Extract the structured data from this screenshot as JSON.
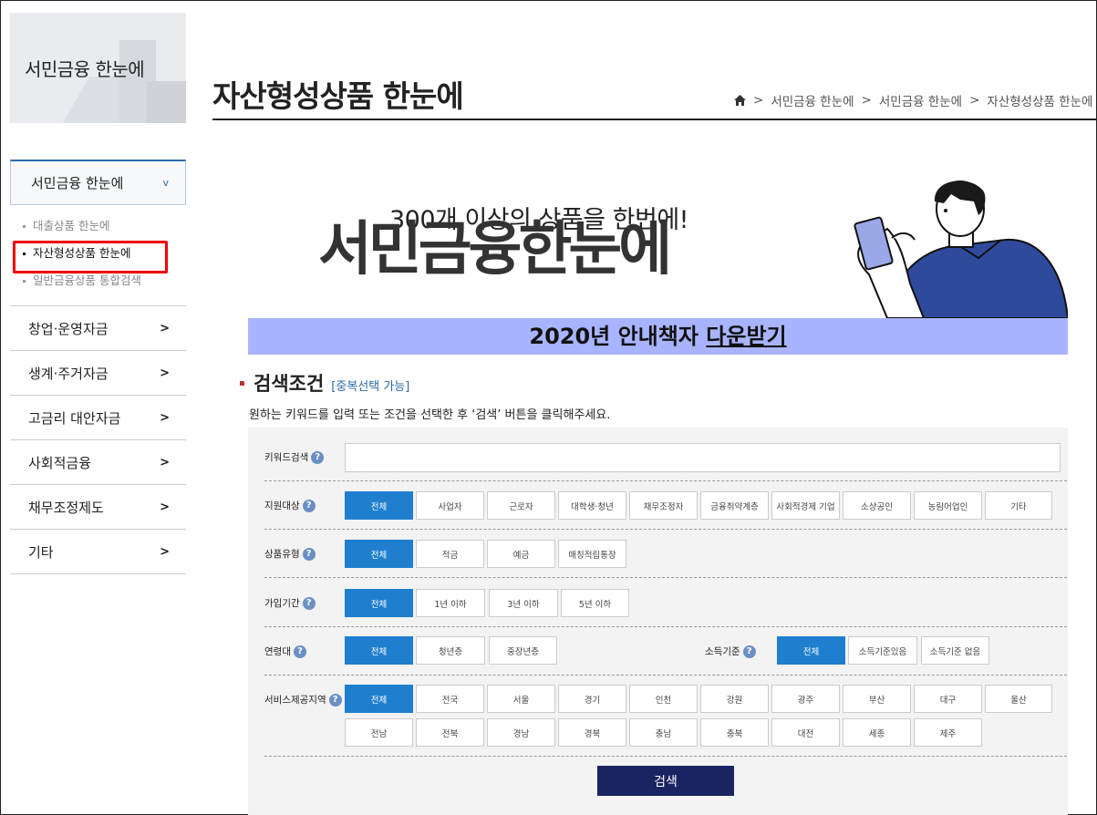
{
  "sidebar": {
    "title": "서민금융 한눈에",
    "open_menu": {
      "label": "서민금융 한눈에",
      "chevron": "v"
    },
    "submenu": [
      "대출상품 한눈에",
      "자산형성상품 한눈에",
      "일반금융상품 통합검색"
    ],
    "menus": [
      "창업·운영자금",
      "생계·주거자금",
      "고금리 대안자금",
      "사회적금융",
      "채무조정제도",
      "기타"
    ],
    "arrow": ">"
  },
  "page": {
    "title": "자산형성상품 한눈에",
    "breadcrumb": [
      "서민금융 한눈에",
      "서민금융 한눈에",
      "자산형성상품 한눈에"
    ],
    "breadcrumb_sep": ">"
  },
  "banner": {
    "subtitle": "300개 이상의 상품을 한번에!",
    "main": "서민금융한눈에",
    "download_prefix": "2020년 안내책자 ",
    "download_link": "다운받기",
    "bar_color": "#a8b4ff"
  },
  "search": {
    "title": "검색조건",
    "note": "[중복선택 가능]",
    "desc": "원하는 키워드를 입력 또는 조건을 선택한 후 ‘검색’ 버튼을 클릭해주세요.",
    "keyword_label": "키워드검색",
    "keyword_value": "",
    "target_label": "지원대상",
    "target_options": [
      "전체",
      "사업자",
      "근로자",
      "대학생·청년",
      "채무조정자",
      "금융취약계층",
      "사회적경제 기업",
      "소상공인",
      "농림어업인",
      "기타"
    ],
    "type_label": "상품유형",
    "type_options": [
      "전체",
      "적금",
      "예금",
      "매칭적립통장"
    ],
    "period_label": "가입기간",
    "period_options": [
      "전체",
      "1년 이하",
      "3년 이하",
      "5년 이하"
    ],
    "age_label": "연령대",
    "age_options": [
      "전체",
      "청년층",
      "중장년층"
    ],
    "income_label": "소득기준",
    "income_options": [
      "전체",
      "소득기준있음",
      "소득기준 없음"
    ],
    "region_label": "서비스제공지역",
    "region_options_row1": [
      "전체",
      "전국",
      "서울",
      "경기",
      "인천",
      "강원",
      "광주",
      "부산",
      "대구",
      "울산"
    ],
    "region_options_row2": [
      "전남",
      "전북",
      "경남",
      "경북",
      "충남",
      "충북",
      "대전",
      "세종",
      "제주"
    ],
    "help_glyph": "?",
    "search_button": "검색",
    "accent_color": "#1f7fce",
    "button_color": "#1b2463"
  }
}
